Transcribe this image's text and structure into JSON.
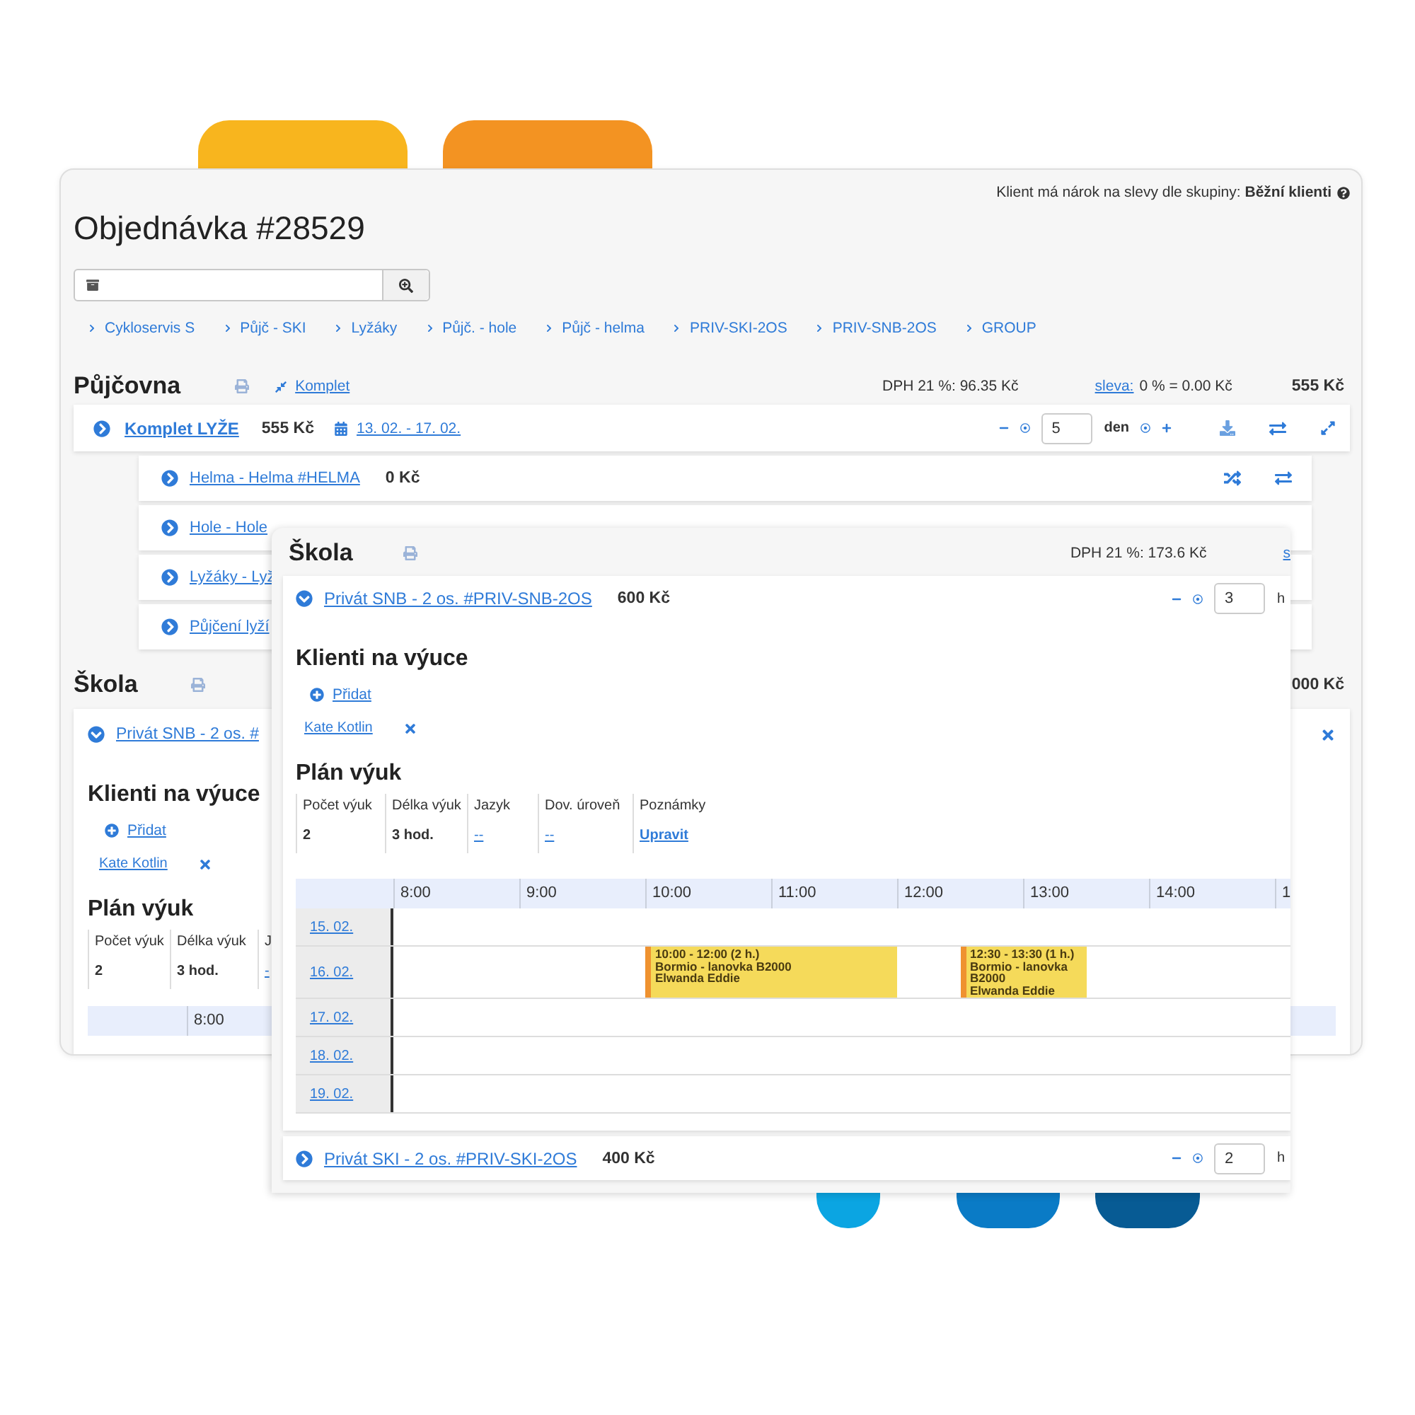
{
  "decorations": [
    {
      "kind": "top",
      "color": "#f8b51e"
    },
    {
      "kind": "top",
      "color": "#f39322"
    },
    {
      "kind": "bottom",
      "color": "#0ba5e2"
    },
    {
      "kind": "bottom",
      "color": "#0a7bc6"
    },
    {
      "kind": "bottom",
      "color": "#075b94"
    }
  ],
  "order_window": {
    "discount_note": "Klient má nárok na slevy dle skupiny: **Běžní klienti**",
    "title": "Objednávka #28529",
    "breadcrumbs": [
      "Cykloservis S",
      "Půjč - SKI",
      "Lyžáky",
      "Půjč. - hole",
      "Půjč - helma",
      "PRIV-SKI-2OS",
      "PRIV-SNB-2OS",
      "GROUP"
    ],
    "rental": {
      "heading": "Půjčovna",
      "bundle_link": "Komplet",
      "vat": "DPH 21 %: 96.35 Kč",
      "discount_label": "sleva:",
      "discount_value": "0 % = 0.00 Kč",
      "total": "555 Kč",
      "item": {
        "name": "Komplet LYŽE",
        "price": "555 Kč",
        "dates": "13. 02. - 17. 02.",
        "quantity": "5",
        "unit": "den"
      },
      "sub_items": [
        {
          "name": "Helma - Helma #HELMA",
          "price": "0 Kč",
          "kind": "actions"
        },
        {
          "name": "Hole - Hole",
          "kind": "plain"
        },
        {
          "name": "Lyžáky - Lyž",
          "kind": "plain"
        },
        {
          "name": "Půjčení lyží",
          "kind": "plain"
        }
      ]
    },
    "school": {
      "heading": "Škola",
      "total": "000 Kč",
      "lesson": {
        "name": "Privát SNB - 2 os. #",
        "expanded": true,
        "clients_heading": "Klienti na výuce",
        "add_label": "Přidat",
        "clients": [
          "Kate Kotlin"
        ],
        "plan_heading": "Plán výuk",
        "plan": [
          {
            "label": "Počet výuk",
            "value": "2",
            "kind": "text"
          },
          {
            "label": "Délka výuk",
            "value": "3 hod.",
            "kind": "text"
          },
          {
            "label": "J",
            "value": "-",
            "kind": "link"
          }
        ],
        "hours": [
          "8:00"
        ]
      }
    }
  },
  "school_panel": {
    "heading": "Škola",
    "vat": "DPH 21 %: 173.6 Kč",
    "discount_label": "s",
    "lessons": [
      {
        "name": "Privát SNB - 2 os. #PRIV-SNB-2OS",
        "price": "600 Kč",
        "hours": "3",
        "unit": "h",
        "expanded": true,
        "clients_heading": "Klienti na výuce",
        "add_label": "Přidat",
        "clients": [
          "Kate Kotlin"
        ],
        "plan_heading": "Plán výuk",
        "plan": [
          {
            "label": "Počet výuk",
            "value": "2",
            "kind": "text"
          },
          {
            "label": "Délka výuk",
            "value": "3 hod.",
            "kind": "text"
          },
          {
            "label": "Jazyk",
            "value": "--",
            "kind": "link"
          },
          {
            "label": "Dov. úroveň",
            "value": "--",
            "kind": "link"
          },
          {
            "label": "Poznámky",
            "value": "Upravit",
            "kind": "action"
          }
        ],
        "schedule": {
          "hours": [
            "8:00",
            "9:00",
            "10:00",
            "11:00",
            "12:00",
            "13:00",
            "14:00",
            "1"
          ],
          "days": [
            {
              "date": "15. 02."
            },
            {
              "date": "16. 02.",
              "events": [
                {
                  "time": "10:00 - 12:00 (2 h.)",
                  "place": "Bormio - lanovka B2000",
                  "client": "Elwanda Eddie"
                },
                {
                  "time": "12:30 - 13:30 (1 h.)",
                  "place": "Bormio - lanovka B2000",
                  "client": "Elwanda Eddie"
                }
              ]
            },
            {
              "date": "17. 02."
            },
            {
              "date": "18. 02."
            },
            {
              "date": "19. 02."
            }
          ]
        }
      },
      {
        "name": "Privát SKI - 2 os. #PRIV-SKI-2OS",
        "price": "400 Kč",
        "hours": "2",
        "unit": "h",
        "expanded": false
      }
    ]
  }
}
